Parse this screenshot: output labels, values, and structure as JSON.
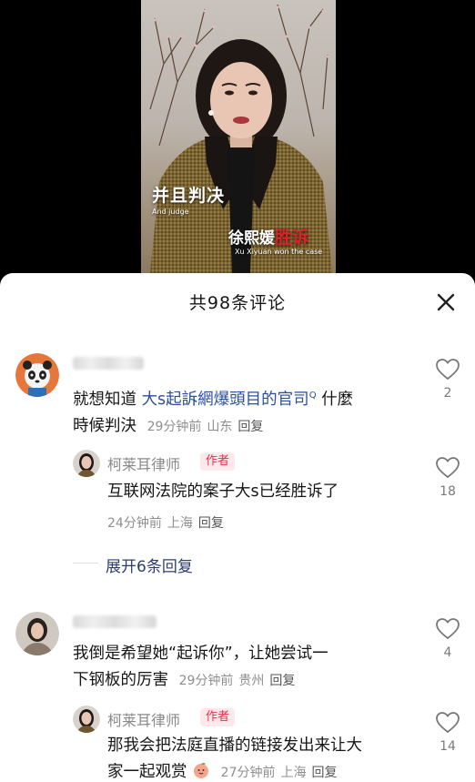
{
  "video": {
    "caption_cn": "并且判决",
    "caption_en": "And judge",
    "caption2_name": "徐熙媛",
    "caption2_win": "胜诉",
    "caption2_en": "Xu Xiyuan won the case"
  },
  "sheet": {
    "title": "共98条评论"
  },
  "comments": [
    {
      "text_before": "就想知道 ",
      "text_link": "大s起訴網爆頭目的官司",
      "text_after": " 什麼",
      "text_line2": "時候判決",
      "time": "29分钟前",
      "location": "山东",
      "reply_label": "回复",
      "likes": "2",
      "author_reply": {
        "name": "柯莱耳律师",
        "tag": "作者",
        "text": "互联网法院的案子大s已经胜诉了",
        "time": "24分钟前",
        "location": "上海",
        "reply_label": "回复",
        "likes": "18"
      },
      "expand_label": "展开6条回复"
    },
    {
      "text_line1": "我倒是希望她“起诉你”，让她尝试一",
      "text_line2": "下钢板的厉害",
      "time": "29分钟前",
      "location": "贵州",
      "reply_label": "回复",
      "likes": "4",
      "author_reply": {
        "name": "柯莱耳律师",
        "tag": "作者",
        "text_line1": "那我会把法庭直播的链接发出来让大",
        "text_line2": "家一起观赏",
        "time": "27分钟前",
        "location": "上海",
        "reply_label": "回复",
        "likes": "14"
      }
    }
  ],
  "colors": {
    "author_tag": "#e0334d",
    "link": "#2b4f9e"
  }
}
